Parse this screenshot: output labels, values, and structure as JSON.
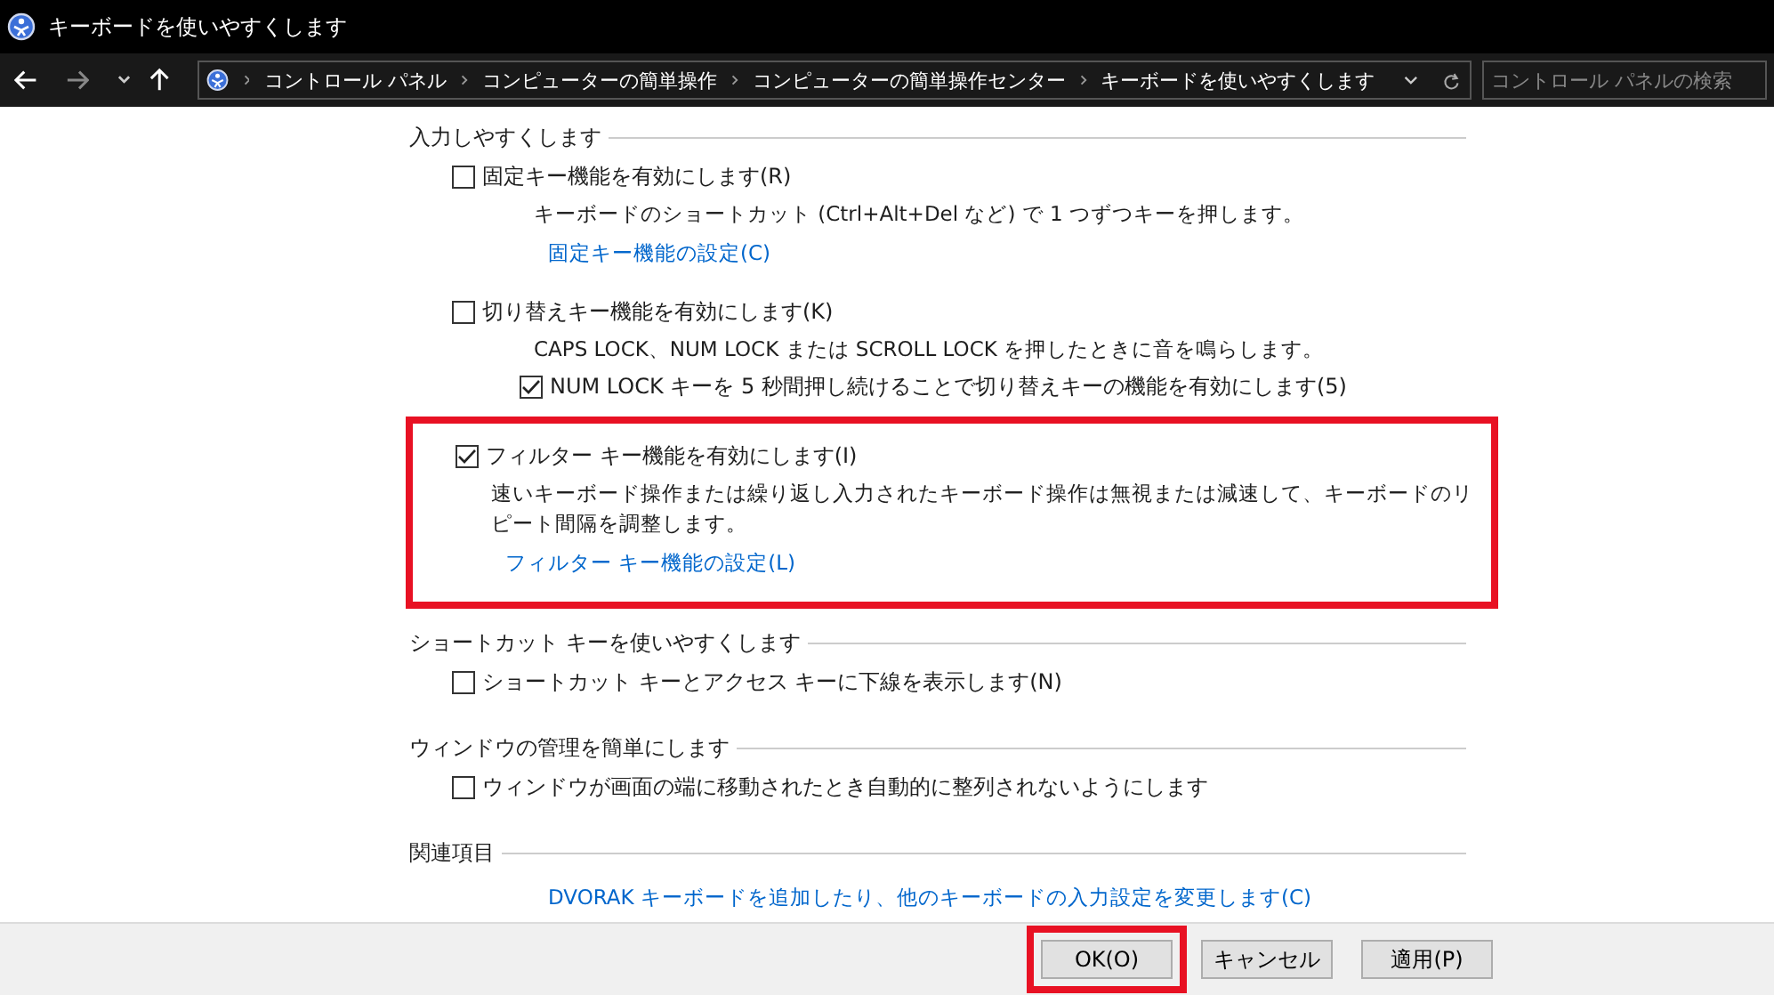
{
  "window": {
    "title": "キーボードを使いやすくします"
  },
  "address_bar": {
    "crumbs": [
      "コントロール パネル",
      "コンピューターの簡単操作",
      "コンピューターの簡単操作センター",
      "キーボードを使いやすくします"
    ],
    "search": {
      "placeholder": "コントロール パネルの検索"
    }
  },
  "sections": [
    {
      "heading": "入力しやすくします",
      "groups": [
        {
          "highlighted": false,
          "items": [
            {
              "kind": "checkbox",
              "label": "固定キー機能を有効にします(R)",
              "checked": false
            },
            {
              "kind": "text",
              "text": "キーボードのショートカット (Ctrl+Alt+Del など) で 1 つずつキーを押します。"
            },
            {
              "kind": "link",
              "text": "固定キー機能の設定(C)"
            }
          ]
        },
        {
          "highlighted": false,
          "items": [
            {
              "kind": "checkbox",
              "label": "切り替えキー機能を有効にします(K)",
              "checked": false
            },
            {
              "kind": "text",
              "text": "CAPS LOCK、NUM LOCK または SCROLL LOCK を押したときに音を鳴らします。"
            },
            {
              "kind": "subcheckbox",
              "label": "NUM LOCK キーを 5 秒間押し続けることで切り替えキーの機能を有効にします(5)",
              "checked": true
            }
          ]
        },
        {
          "highlighted": true,
          "items": [
            {
              "kind": "checkbox",
              "label": "フィルター キー機能を有効にします(I)",
              "checked": true
            },
            {
              "kind": "text",
              "text": "速いキーボード操作または繰り返し入力されたキーボード操作は無視または減速して、キーボードのリピート間隔を調整します。"
            },
            {
              "kind": "link",
              "text": "フィルター キー機能の設定(L)"
            }
          ]
        }
      ]
    },
    {
      "heading": "ショートカット キーを使いやすくします",
      "groups": [
        {
          "highlighted": false,
          "items": [
            {
              "kind": "checkbox",
              "label": "ショートカット キーとアクセス キーに下線を表示します(N)",
              "checked": false
            }
          ]
        }
      ]
    },
    {
      "heading": "ウィンドウの管理を簡単にします",
      "groups": [
        {
          "highlighted": false,
          "items": [
            {
              "kind": "checkbox",
              "label": "ウィンドウが画面の端に移動されたとき自動的に整列されないようにします",
              "checked": false
            }
          ]
        }
      ]
    },
    {
      "heading": "関連項目",
      "groups": [
        {
          "highlighted": false,
          "items": [
            {
              "kind": "link",
              "text": "DVORAK キーボードを追加したり、他のキーボードの入力設定を変更します(C)"
            }
          ]
        }
      ]
    }
  ],
  "buttons": [
    {
      "label": "OK(O)",
      "highlighted": true
    },
    {
      "label": "キャンセル",
      "highlighted": false
    },
    {
      "label": "適用(P)",
      "highlighted": false
    }
  ]
}
